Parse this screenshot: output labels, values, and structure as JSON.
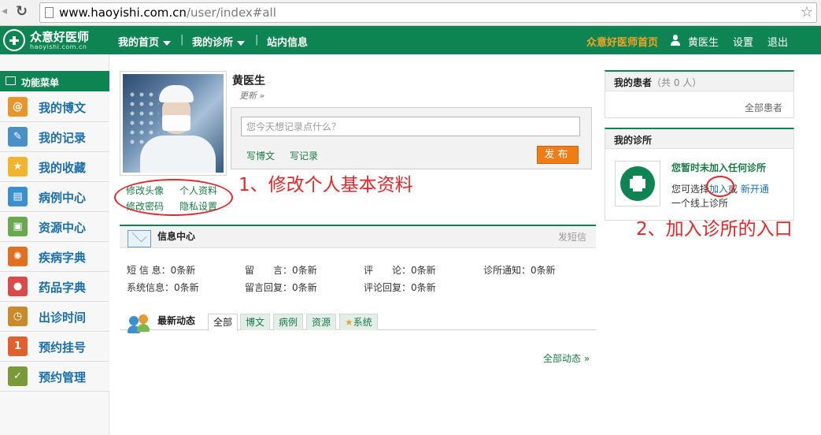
{
  "browser": {
    "url_host": "www.haoyishi.com.cn",
    "url_path": "/user/index#all"
  },
  "topnav": {
    "logo_text": "众意好医师",
    "logo_sub": "haoyishi.com.cn",
    "items": [
      "我的首页",
      "我的诊所",
      "站内信息"
    ],
    "site_home": "众意好医师首页",
    "user_name": "黄医生",
    "settings": "设置",
    "logout": "退出"
  },
  "sidebar": {
    "header": "功能菜单",
    "items": [
      {
        "label": "我的博文",
        "icon": "at-icon",
        "glyph": "@",
        "color": "#e8952d"
      },
      {
        "label": "我的记录",
        "icon": "notepad-icon",
        "glyph": "✎",
        "color": "#4a90c8"
      },
      {
        "label": "我的收藏",
        "icon": "bookmark-icon",
        "glyph": "★",
        "color": "#f0b52d"
      },
      {
        "label": "病例中心",
        "icon": "clipboard-icon",
        "glyph": "▤",
        "color": "#3a8fd0"
      },
      {
        "label": "资源中心",
        "icon": "picture-icon",
        "glyph": "▣",
        "color": "#6aa84f"
      },
      {
        "label": "疾病字典",
        "icon": "virus-icon",
        "glyph": "✺",
        "color": "#e07020"
      },
      {
        "label": "药品字典",
        "icon": "pills-icon",
        "glyph": "●",
        "color": "#d94a4a"
      },
      {
        "label": "出诊时间",
        "icon": "clock-icon",
        "glyph": "◷",
        "color": "#c88a2a"
      },
      {
        "label": "预约挂号",
        "icon": "number-one-icon",
        "glyph": "1",
        "color": "#e06030"
      },
      {
        "label": "预约管理",
        "icon": "check-clock-icon",
        "glyph": "✓",
        "color": "#7a9a3a"
      }
    ]
  },
  "profile": {
    "name": "黄医生",
    "update": "更新 »",
    "links": {
      "change_avatar": "修改头像",
      "personal_info": "个人资料",
      "change_password": "修改密码",
      "privacy": "隐私设置"
    },
    "post_placeholder": "您今天想记录点什么？",
    "write_blog": "写博文",
    "write_record": "写记录",
    "publish": "发布"
  },
  "annotations": {
    "note1": "1、修改个人基本资料",
    "note2": "2、加入诊所的入口",
    "color": "#e3262a"
  },
  "info_center": {
    "title": "信息中心",
    "send_message": "发短信",
    "stats": [
      [
        "短 信 息：0条新",
        "留　　言：0条新",
        "评　　论：0条新",
        "诊所通知：0条新"
      ],
      [
        "系统信息：0条新",
        "留言回复：0条新",
        "评论回复：0条新"
      ]
    ]
  },
  "activity": {
    "title": "最新动态",
    "tabs": [
      "全部",
      "博文",
      "病例",
      "资源",
      "系统"
    ],
    "all_link": "全部动态 »"
  },
  "patients": {
    "title": "我的患者",
    "count": "（共 0 人）",
    "all_link": "全部患者"
  },
  "clinic": {
    "title": "我的诊所",
    "status": "您暂时未加入任何诊所",
    "line1_prefix": "您可选择",
    "join": "加入",
    "or": "或",
    "new_open": "新开通",
    "line2": "一个线上诊所"
  },
  "colors": {
    "brand_green": "#0e8452",
    "accent_orange": "#f07c16",
    "link_blue": "#1b6fa6"
  }
}
